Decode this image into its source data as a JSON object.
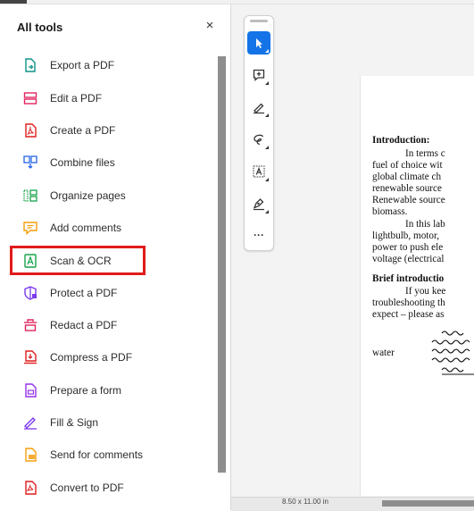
{
  "panel": {
    "title": "All tools",
    "close_symbol": "×",
    "tools": [
      {
        "label": "Export a PDF",
        "icon": "export-pdf-icon",
        "color": "#0d9488"
      },
      {
        "label": "Edit a PDF",
        "icon": "edit-pdf-icon",
        "color": "#e0245e"
      },
      {
        "label": "Create a PDF",
        "icon": "create-pdf-icon",
        "color": "#e11d1d"
      },
      {
        "label": "Combine files",
        "icon": "combine-files-icon",
        "color": "#2563eb"
      },
      {
        "label": "Organize pages",
        "icon": "organize-pages-icon",
        "color": "#16a34a"
      },
      {
        "label": "Add comments",
        "icon": "add-comments-icon",
        "color": "#f59e0b"
      },
      {
        "label": "Scan & OCR",
        "icon": "scan-ocr-icon",
        "color": "#16a34a"
      },
      {
        "label": "Protect a PDF",
        "icon": "protect-pdf-icon",
        "color": "#7c3aed"
      },
      {
        "label": "Redact a PDF",
        "icon": "redact-pdf-icon",
        "color": "#e0245e"
      },
      {
        "label": "Compress a PDF",
        "icon": "compress-pdf-icon",
        "color": "#e11d1d"
      },
      {
        "label": "Prepare a form",
        "icon": "prepare-form-icon",
        "color": "#9333ea"
      },
      {
        "label": "Fill & Sign",
        "icon": "fill-sign-icon",
        "color": "#7c3aed"
      },
      {
        "label": "Send for comments",
        "icon": "send-comments-icon",
        "color": "#f59e0b"
      },
      {
        "label": "Convert to PDF",
        "icon": "convert-pdf-icon",
        "color": "#e11d1d"
      }
    ],
    "highlighted_tool": "Scan & OCR"
  },
  "toolbar": {
    "more_label": "···",
    "buttons": [
      "select-cursor-icon",
      "add-comment-icon",
      "highlight-pen-icon",
      "freehand-draw-icon",
      "text-box-icon",
      "sign-icon"
    ]
  },
  "document": {
    "lines": [
      "Introduction:",
      "In terms c",
      "fuel of choice wit",
      "global climate ch",
      "renewable source",
      "Renewable source",
      "biomass.",
      "In this lab",
      "lightbulb, motor,",
      "power to push ele",
      "voltage (electrical",
      "Brief introductio",
      "If you kee",
      "troubleshooting th",
      "expect – please as",
      "water"
    ]
  },
  "status": {
    "page_size": "8.50 x 11.00 in"
  },
  "colors": {
    "accent": "#1473e6",
    "highlight_box": "#e01b1b"
  }
}
